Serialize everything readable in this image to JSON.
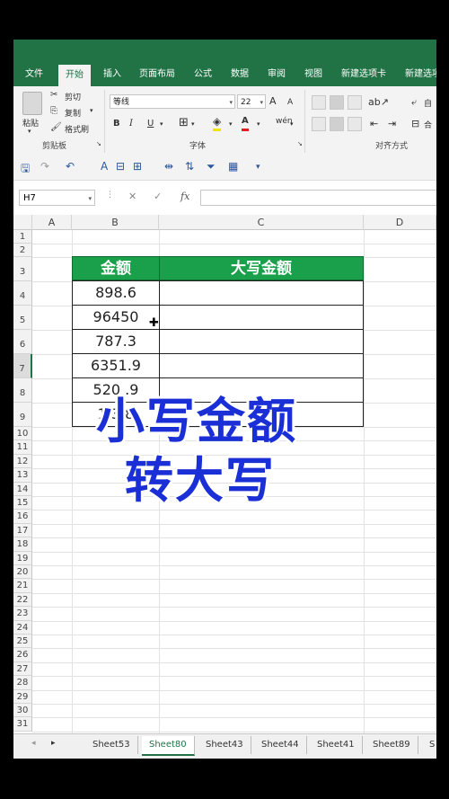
{
  "ribbon_tabs": [
    "文件",
    "开始",
    "插入",
    "页面布局",
    "公式",
    "数据",
    "审阅",
    "视图",
    "新建选项卡",
    "新建选项卡"
  ],
  "clipboard": {
    "paste": "粘贴",
    "cut": "剪切",
    "copy": "复制",
    "format_painter": "格式刷",
    "group": "剪贴板"
  },
  "font": {
    "name": "等线",
    "size": "22",
    "bold": "B",
    "italic": "I",
    "underline": "U",
    "group": "字体",
    "grow": "A",
    "shrink": "A"
  },
  "alignment": {
    "wrap": "自",
    "merge": "合",
    "group": "对齐方式"
  },
  "name_box": "H7",
  "fx": "fx",
  "columns": [
    "A",
    "B",
    "C",
    "D"
  ],
  "rows": [
    "1",
    "2",
    "3",
    "4",
    "5",
    "6",
    "7",
    "8",
    "9",
    "10",
    "11",
    "12",
    "13",
    "14",
    "15",
    "16",
    "17",
    "18",
    "19",
    "20",
    "21",
    "22",
    "23",
    "24",
    "25",
    "26",
    "27",
    "28",
    "29",
    "30",
    "31"
  ],
  "table": {
    "header_amount": "金额",
    "header_upper": "大写金额",
    "values": [
      "898.6",
      "96450",
      "787.3",
      "6351.9",
      "520 .9",
      "1 3 8"
    ]
  },
  "overlay": {
    "line1": "小写金额",
    "line2": "转大写"
  },
  "sheet_tabs": [
    "Sheet53",
    "Sheet80",
    "Sheet43",
    "Sheet44",
    "Sheet41",
    "Sheet89",
    "S"
  ],
  "active_sheet": "Sheet80",
  "colors": {
    "excel_green": "#217346",
    "header_green": "#1aa04a",
    "overlay_blue": "#1a2fd6"
  }
}
